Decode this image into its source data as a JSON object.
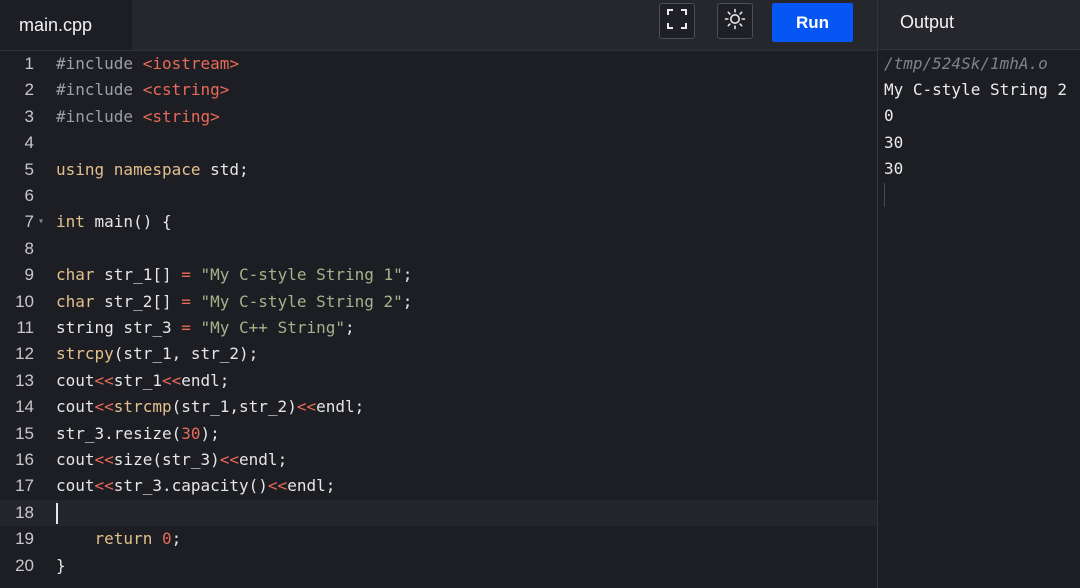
{
  "editor": {
    "filename": "main.cpp",
    "run_label": "Run",
    "colors": {
      "text": "#e6e6e6",
      "keyword": "#e2c08d",
      "string": "#a8b08c",
      "include_target": "#e86a5a",
      "number": "#e86a5a",
      "operator": "#e86a5a",
      "preprocessor": "#9d9fa6",
      "return": "#e2c08d"
    },
    "lines": [
      {
        "n": "1",
        "tokens": [
          {
            "t": "#include ",
            "c": "preprocessor"
          },
          {
            "t": "<iostream>",
            "c": "include_target"
          }
        ]
      },
      {
        "n": "2",
        "tokens": [
          {
            "t": "#include ",
            "c": "preprocessor"
          },
          {
            "t": "<cstring>",
            "c": "include_target"
          }
        ]
      },
      {
        "n": "3",
        "tokens": [
          {
            "t": "#include ",
            "c": "preprocessor"
          },
          {
            "t": "<string>",
            "c": "include_target"
          }
        ]
      },
      {
        "n": "4",
        "tokens": []
      },
      {
        "n": "5",
        "tokens": [
          {
            "t": "using namespace ",
            "c": "keyword"
          },
          {
            "t": "std;",
            "c": "text"
          }
        ]
      },
      {
        "n": "6",
        "tokens": []
      },
      {
        "n": "7",
        "fold": true,
        "tokens": [
          {
            "t": "int ",
            "c": "keyword"
          },
          {
            "t": "main() {",
            "c": "text"
          }
        ]
      },
      {
        "n": "8",
        "tokens": []
      },
      {
        "n": "9",
        "tokens": [
          {
            "t": "char ",
            "c": "keyword"
          },
          {
            "t": "str_1[] ",
            "c": "text"
          },
          {
            "t": "= ",
            "c": "operator"
          },
          {
            "t": "\"My C-style String 1\"",
            "c": "string"
          },
          {
            "t": ";",
            "c": "text"
          }
        ]
      },
      {
        "n": "10",
        "tokens": [
          {
            "t": "char ",
            "c": "keyword"
          },
          {
            "t": "str_2[] ",
            "c": "text"
          },
          {
            "t": "= ",
            "c": "operator"
          },
          {
            "t": "\"My C-style String 2\"",
            "c": "string"
          },
          {
            "t": ";",
            "c": "text"
          }
        ]
      },
      {
        "n": "11",
        "tokens": [
          {
            "t": "string str_3 ",
            "c": "text"
          },
          {
            "t": "= ",
            "c": "operator"
          },
          {
            "t": "\"My C++ String\"",
            "c": "string"
          },
          {
            "t": ";",
            "c": "text"
          }
        ]
      },
      {
        "n": "12",
        "tokens": [
          {
            "t": "strcpy",
            "c": "keyword"
          },
          {
            "t": "(str_1, str_2);",
            "c": "text"
          }
        ]
      },
      {
        "n": "13",
        "tokens": [
          {
            "t": "cout",
            "c": "text"
          },
          {
            "t": "<<",
            "c": "operator"
          },
          {
            "t": "str_1",
            "c": "text"
          },
          {
            "t": "<<",
            "c": "operator"
          },
          {
            "t": "endl;",
            "c": "text"
          }
        ]
      },
      {
        "n": "14",
        "tokens": [
          {
            "t": "cout",
            "c": "text"
          },
          {
            "t": "<<",
            "c": "operator"
          },
          {
            "t": "strcmp",
            "c": "keyword"
          },
          {
            "t": "(str_1,str_2)",
            "c": "text"
          },
          {
            "t": "<<",
            "c": "operator"
          },
          {
            "t": "endl;",
            "c": "text"
          }
        ]
      },
      {
        "n": "15",
        "tokens": [
          {
            "t": "str_3.resize(",
            "c": "text"
          },
          {
            "t": "30",
            "c": "number"
          },
          {
            "t": ");",
            "c": "text"
          }
        ]
      },
      {
        "n": "16",
        "tokens": [
          {
            "t": "cout",
            "c": "text"
          },
          {
            "t": "<<",
            "c": "operator"
          },
          {
            "t": "size(str_3)",
            "c": "text"
          },
          {
            "t": "<<",
            "c": "operator"
          },
          {
            "t": "endl;",
            "c": "text"
          }
        ]
      },
      {
        "n": "17",
        "tokens": [
          {
            "t": "cout",
            "c": "text"
          },
          {
            "t": "<<",
            "c": "operator"
          },
          {
            "t": "str_3.capacity()",
            "c": "text"
          },
          {
            "t": "<<",
            "c": "operator"
          },
          {
            "t": "endl;",
            "c": "text"
          }
        ]
      },
      {
        "n": "18",
        "active": true,
        "cursor": true,
        "tokens": []
      },
      {
        "n": "19",
        "tokens": [
          {
            "t": "    ",
            "c": "text"
          },
          {
            "t": "return ",
            "c": "return"
          },
          {
            "t": "0",
            "c": "number"
          },
          {
            "t": ";",
            "c": "text"
          }
        ]
      },
      {
        "n": "20",
        "tokens": [
          {
            "t": "}",
            "c": "text"
          }
        ]
      }
    ]
  },
  "toolbar": {
    "fullscreen_icon": "fullscreen-icon",
    "theme_icon": "sun-icon"
  },
  "output": {
    "title": "Output",
    "path": "/tmp/524Sk/1mhA.o",
    "lines": [
      "My C-style String 2",
      "0",
      "30",
      "30"
    ]
  }
}
